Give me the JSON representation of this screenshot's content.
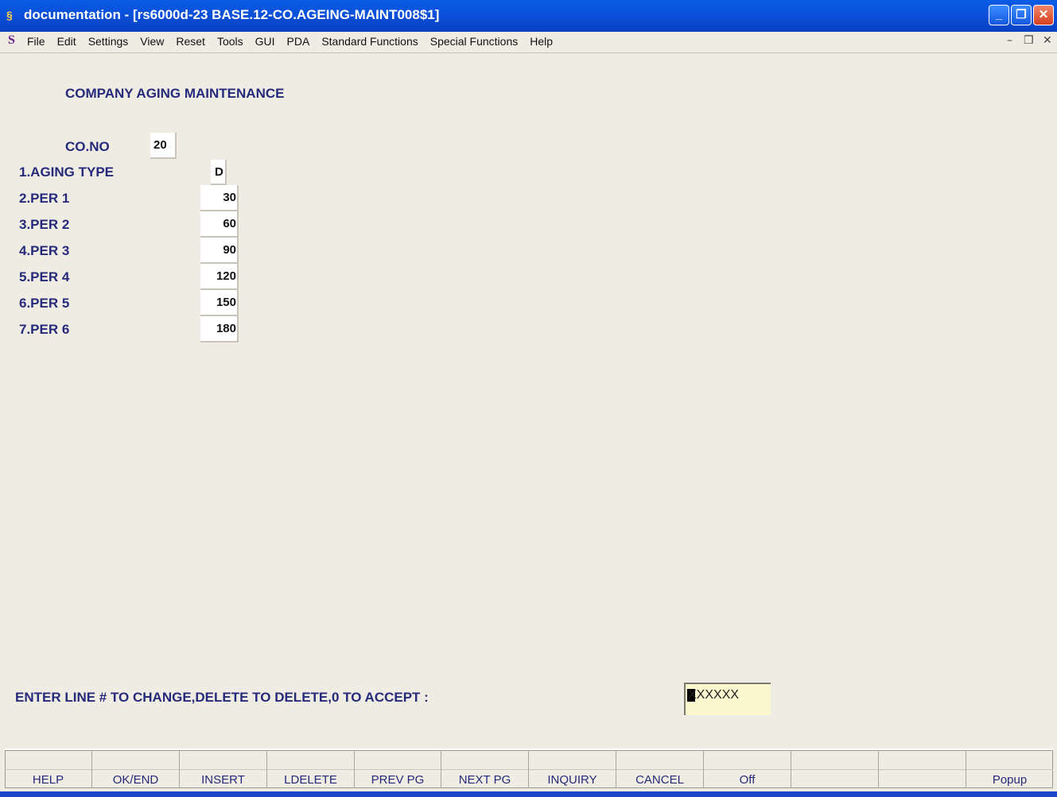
{
  "window": {
    "app_icon": "sh-app-icon",
    "title": "documentation - [rs6000d-23 BASE.12-CO.AGEING-MAINT008$1]",
    "controls": [
      "minimize",
      "restore",
      "close"
    ]
  },
  "menu": {
    "icon": "sh-menu-icon",
    "items": [
      "File",
      "Edit",
      "Settings",
      "View",
      "Reset",
      "Tools",
      "GUI",
      "PDA",
      "Standard Functions",
      "Special Functions",
      "Help"
    ]
  },
  "screen": {
    "heading": "COMPANY AGING MAINTENANCE",
    "company": {
      "label": "CO.NO",
      "value": "20"
    },
    "fields": [
      {
        "label": "1.AGING TYPE",
        "value": "D"
      },
      {
        "label": "2.PER 1",
        "value": "30"
      },
      {
        "label": "3.PER 2",
        "value": "60"
      },
      {
        "label": "4.PER 3",
        "value": "90"
      },
      {
        "label": "5.PER 4",
        "value": "120"
      },
      {
        "label": "6.PER 5",
        "value": "150"
      },
      {
        "label": "7.PER 6",
        "value": "180"
      }
    ],
    "prompt": "ENTER LINE # TO CHANGE,DELETE TO DELETE,0 TO ACCEPT  :",
    "command_value": "XXXXXX"
  },
  "function_keys": [
    "HELP",
    "OK/END",
    "INSERT",
    "LDELETE",
    "PREV PG",
    "NEXT PG",
    "INQUIRY",
    "CANCEL",
    "Off",
    "",
    "",
    "Popup"
  ],
  "colors": {
    "title_bar": "#0a4fd8",
    "background": "#efece3",
    "label_text": "#262a7a",
    "input_bg": "#fbf8cf"
  }
}
